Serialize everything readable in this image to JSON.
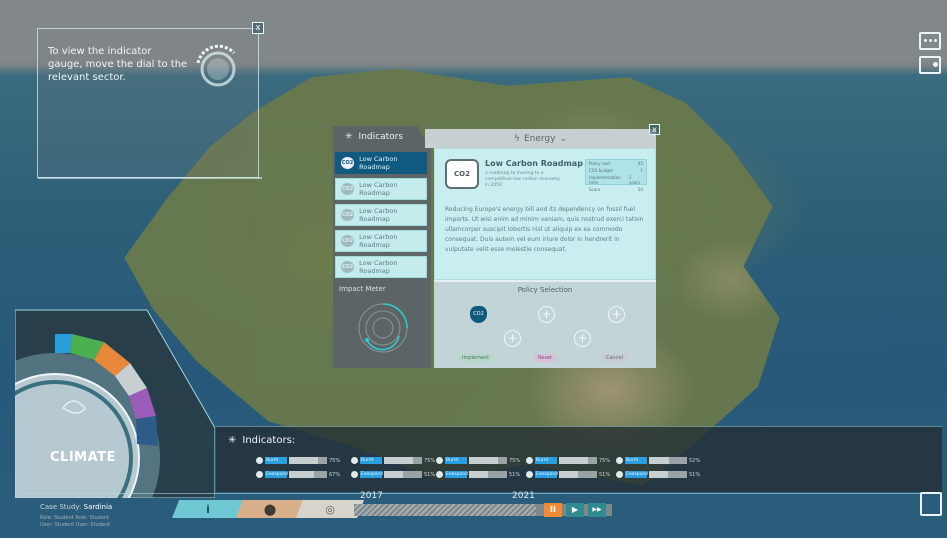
{
  "hint": {
    "text": "To view the indicator gauge, move the dial to the relevant sector.",
    "close_label": "x"
  },
  "panel": {
    "tab_indicators": "Indicators",
    "tab_energy": "Energy",
    "close_label": "x",
    "list_items": [
      "Low Carbon Roadmap",
      "Low Carbon Roadmap",
      "Low Carbon Roadmap",
      "Low Carbon Roadmap",
      "Low Carbon Roadmap"
    ],
    "co2_label": "CO2",
    "detail": {
      "title": "Low Carbon Roadmap",
      "subtitle": "a roadmap to moving to a competitive low carbon economy in 2050",
      "stats": [
        {
          "k": "Policy cost",
          "v": "45"
        },
        {
          "k": "CO2 budget",
          "v": "1"
        },
        {
          "k": "Implementation time",
          "v": "2 years"
        },
        {
          "k": "Score",
          "v": "50"
        }
      ],
      "body": "Reducing Europe's energy bill and its dependency on fossil fuel imports. Ut wisi enim ad minim veniam, quis nostrud exerci tation ullamcorper suscipit lobortis nisl ut aliquip ex ea commodo consequat. Duis autem vel eum iriure dolor in hendrerit in vulputate velit esse molestie consequat."
    },
    "impact_title": "Impact Meter",
    "policy_title": "Policy Selection",
    "policy_buttons": {
      "implement": "Implement",
      "reset": "Reset",
      "cancel": "Cancel"
    },
    "slot_symbol": "+"
  },
  "climate": {
    "label": "CLIMATE"
  },
  "indicators": {
    "title": "Indicators:",
    "groups": [
      {
        "a_label": "Burnt",
        "a_pct": "75%",
        "a_val": 0.75,
        "b_label": "Eeespond",
        "b_pct": "67%",
        "b_val": 0.67
      },
      {
        "a_label": "Burnt",
        "a_pct": "75%",
        "a_val": 0.75,
        "b_label": "Eeespond",
        "b_pct": "51%",
        "b_val": 0.51
      },
      {
        "a_label": "Burnt",
        "a_pct": "75%",
        "a_val": 0.75,
        "b_label": "Eeespond",
        "b_pct": "51%",
        "b_val": 0.51
      },
      {
        "a_label": "Burnt",
        "a_pct": "75%",
        "a_val": 0.75,
        "b_label": "Eeespond",
        "b_pct": "51%",
        "b_val": 0.51
      },
      {
        "a_label": "Burnt",
        "a_pct": "52%",
        "a_val": 0.52,
        "b_label": "Eeespond",
        "b_pct": "51%",
        "b_val": 0.51
      }
    ]
  },
  "case_study": {
    "label": "Case Study:",
    "name": "Sardinia",
    "line1": "Role: Student  Role: Student",
    "line2": "User: Student  User: Student"
  },
  "timeline": {
    "start_year": "2017",
    "current_year": "2021",
    "info_label": "i",
    "pause_label": "II",
    "play_label": "▶",
    "ff_label": "▶▶"
  },
  "colors": {
    "accent": "#2a9fe0",
    "panel_blue": "#0f5a7e",
    "water": "#2a9fe0",
    "green": "#4caf50",
    "orange": "#e8883a",
    "purple": "#9b5bb8",
    "navy": "#2d5c88"
  }
}
